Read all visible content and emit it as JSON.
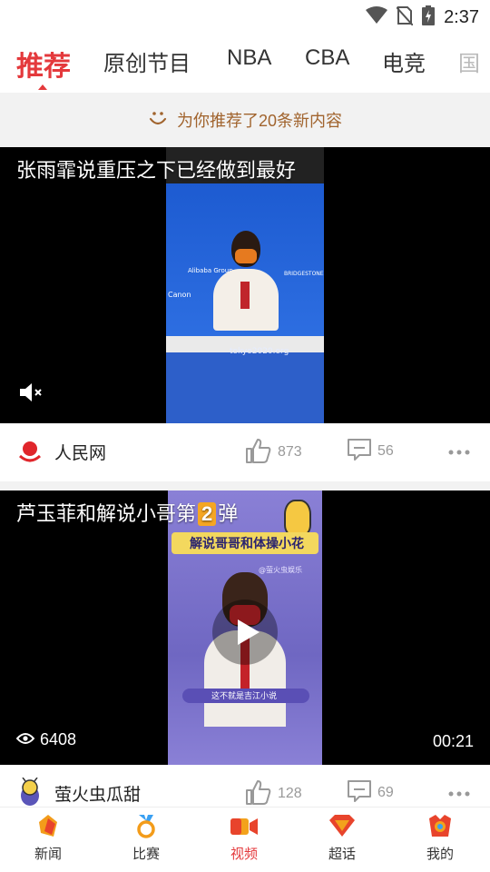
{
  "status_bar": {
    "time": "2:37"
  },
  "tabs": [
    {
      "label": "推荐",
      "active": true
    },
    {
      "label": "原创节目"
    },
    {
      "label": "NBA"
    },
    {
      "label": "CBA"
    },
    {
      "label": "电竞"
    },
    {
      "label": "国"
    }
  ],
  "banner": {
    "text": "为你推荐了20条新内容"
  },
  "cards": [
    {
      "title": "张雨霏说重压之下已经做到最好",
      "thumb_text": {
        "sponsor1": "Alibaba Group",
        "sponsor2": "BRIDGESTONE",
        "sponsor3": "Canon",
        "site": "tokyo2020.org"
      },
      "source": "人民网",
      "likes": "873",
      "comments": "56"
    },
    {
      "title": "芦玉菲和解说小哥第2弹",
      "title_prefix": "芦玉菲和解说小哥第",
      "title_num": "2",
      "title_suffix": "弹",
      "thumb_text": {
        "banner": "解说哥哥和体操小花",
        "watermark": "@萤火虫娱乐",
        "caption": "这不就是吉江小说"
      },
      "views": "6408",
      "duration": "00:21",
      "source": "萤火虫瓜甜",
      "likes": "128",
      "comments": "69"
    }
  ],
  "bottom_nav": [
    {
      "label": "新闻"
    },
    {
      "label": "比赛"
    },
    {
      "label": "视频",
      "active": true
    },
    {
      "label": "超话"
    },
    {
      "label": "我的"
    }
  ],
  "colors": {
    "accent": "#e4393c",
    "banner_text": "#a1642e"
  }
}
